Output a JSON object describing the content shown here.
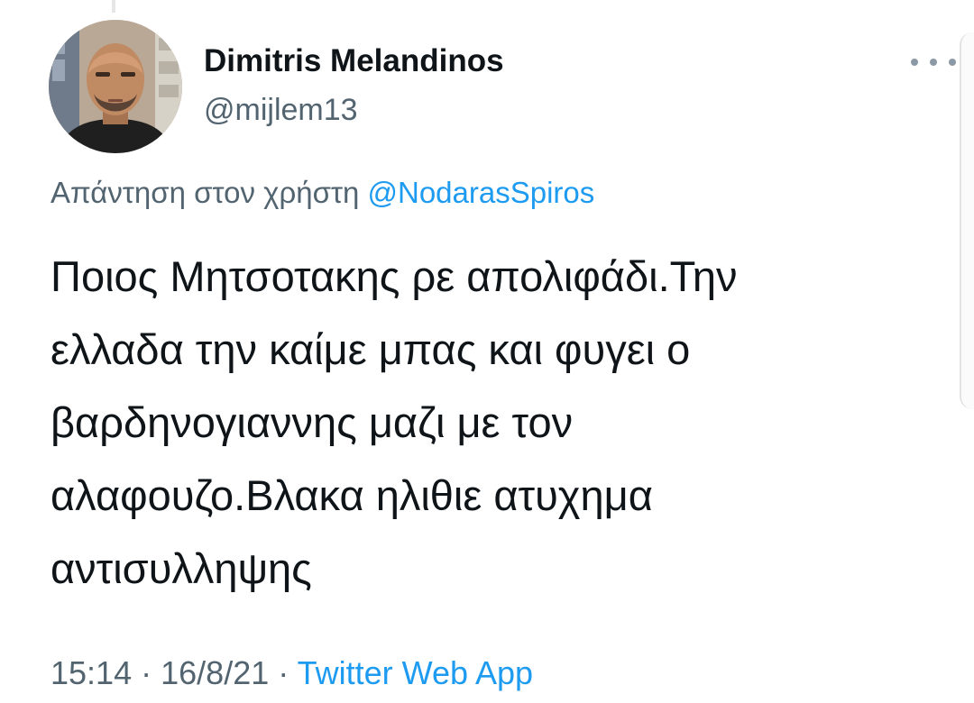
{
  "tweet": {
    "author": {
      "display_name": "Dimitris Melandinos",
      "handle": "@mijlem13",
      "avatar": "profile-photo"
    },
    "more_icon": "more-horizontal-icon",
    "reply_prefix": "Απάντηση στον χρήστη",
    "reply_to": "@NodarasSpiros",
    "text_lines": [
      "Ποιος Μητσοτακης ρε απολιφάδι.Την",
      "ελλαδα την καίμε μπας και φυγει ο",
      "βαρδηνογιαννης μαζι με τον",
      "αλαφουζο.Βλακα ηλιθιε ατυχημα",
      "αντισυλληψης"
    ],
    "time": "15:14",
    "separator": "·",
    "date": "16/8/21",
    "source": "Twitter Web App"
  },
  "colors": {
    "text": "#0f1419",
    "secondary": "#536471",
    "link": "#1d9bf0"
  }
}
